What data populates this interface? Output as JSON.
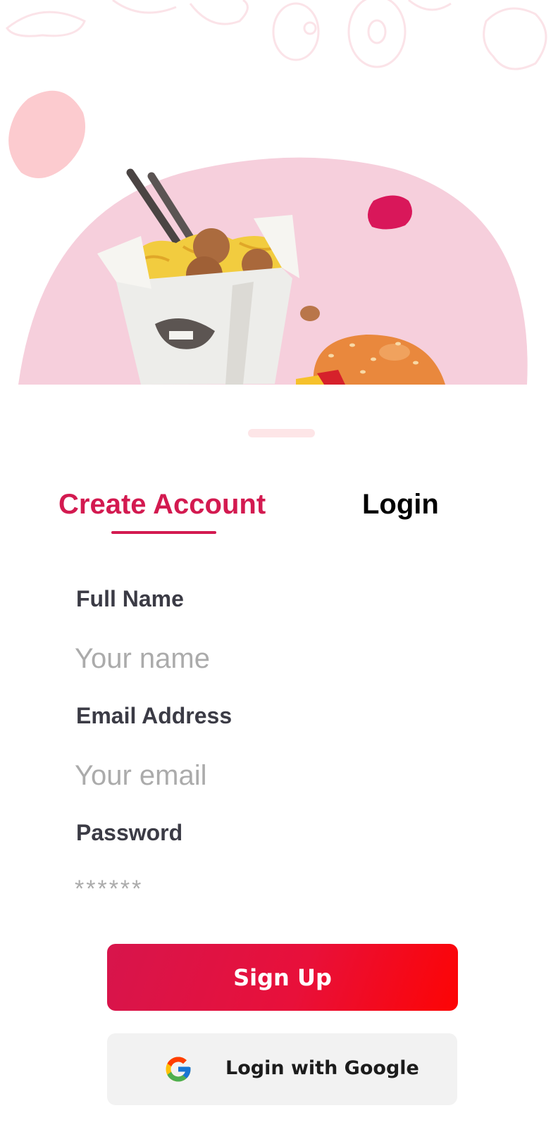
{
  "tabs": {
    "create_account": "Create Account",
    "login": "Login",
    "active_color": "#d31a50"
  },
  "form": {
    "full_name": {
      "label": "Full Name",
      "placeholder": "Your name",
      "value": ""
    },
    "email": {
      "label": "Email Address",
      "placeholder": "Your email",
      "value": ""
    },
    "password": {
      "label": "Password",
      "placeholder": "******",
      "value": ""
    }
  },
  "buttons": {
    "sign_up": "Sign Up",
    "google": "Login with Google"
  },
  "icons": {
    "hero": "food-illustration",
    "google": "google-icon"
  },
  "colors": {
    "brand": "#d31a50",
    "gradient_end": "#fd0404",
    "hero_pink": "#f6cfdc"
  }
}
